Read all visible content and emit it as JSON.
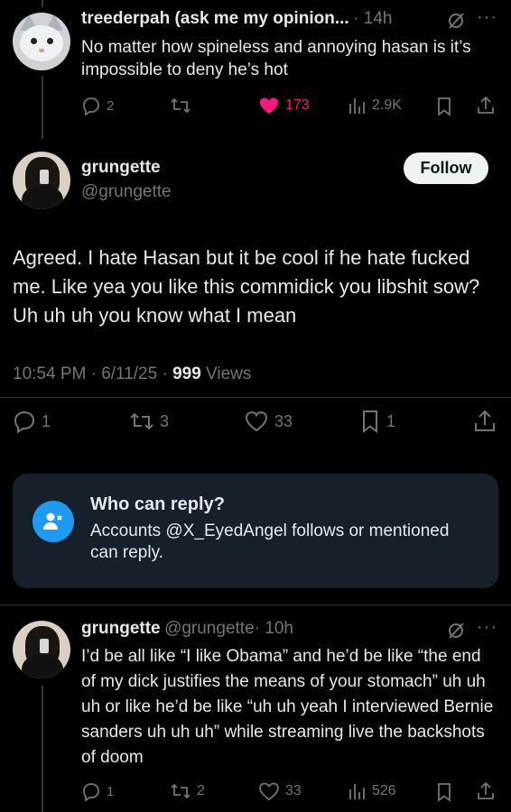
{
  "tweet1": {
    "name": "treederpah (ask me my opinion...",
    "time": "· 14h",
    "text": "No matter how spineless and annoying hasan is it’s impossible to deny he’s hot",
    "replies": "2",
    "retweets": "",
    "likes": "173",
    "views": "2.9K",
    "avatar_icon": "cat-avatar"
  },
  "tweet2": {
    "name": "grungette",
    "handle": "@grungette",
    "follow_label": "Follow",
    "text": "Agreed. I hate Hasan but it be cool if he hate fucked me. Like yea you like this commidick you libshit sow? Uh uh uh you know what I mean",
    "time": "10:54 PM · 6/11/25 · ",
    "views_count": "999",
    "views_label": " Views",
    "replies": "1",
    "retweets": "3",
    "likes": "33",
    "bookmarks": "1"
  },
  "who_can_reply": {
    "title": "Who can reply?",
    "description": "Accounts @X_EyedAngel follows or mentioned can reply."
  },
  "tweet3": {
    "name": "grungette",
    "handle": "@grungette",
    "time": "· 10h",
    "text": "I’d be all like “I like Obama” and he’d be like “the end of my dick justifies the means of your stomach” uh uh uh or like he’d be like “uh uh yeah I interviewed Bernie sanders uh uh uh” while streaming live the backshots of doom",
    "replies": "1",
    "retweets": "2",
    "likes": "33",
    "views": "526"
  },
  "colors": {
    "like_active": "#f91880",
    "accent": "#1d9bf0",
    "muted": "#71767b"
  }
}
